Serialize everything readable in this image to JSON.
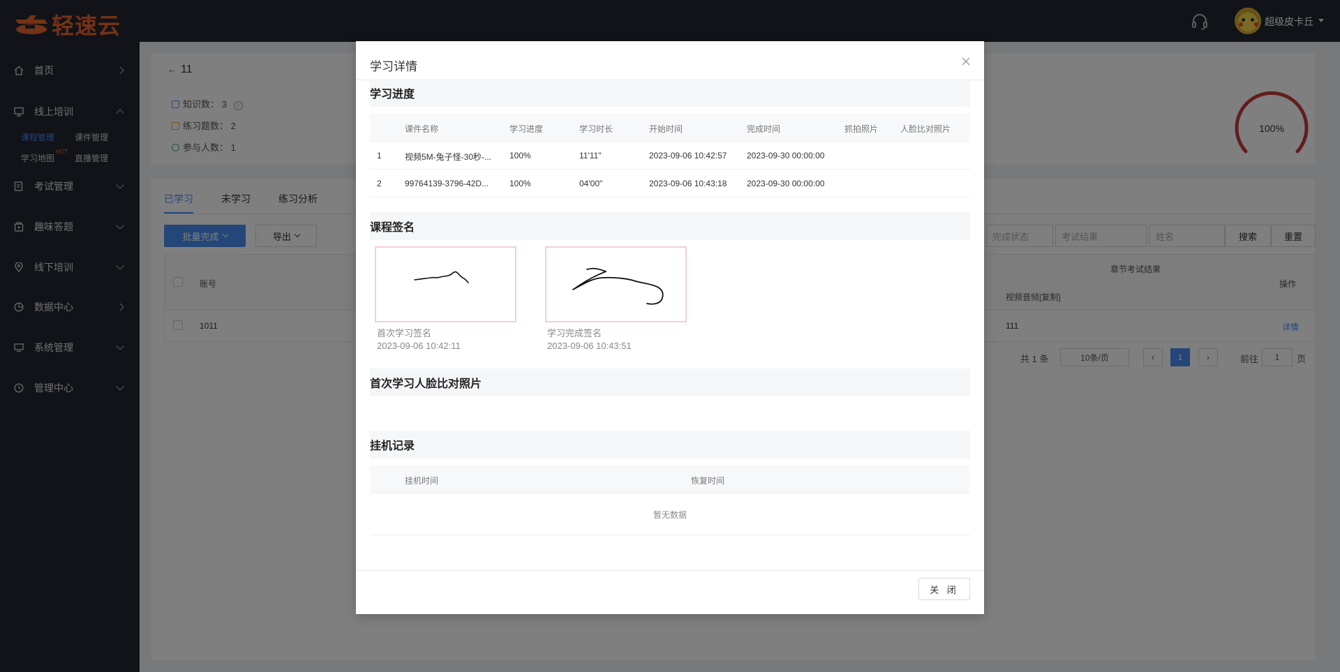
{
  "brand": {
    "logo_text": "轻速云",
    "color": "#e8642c"
  },
  "header": {
    "username": "超级皮卡丘"
  },
  "sidebar": {
    "items": [
      {
        "label": "首页",
        "icon": "home-icon"
      },
      {
        "label": "线上培训",
        "icon": "monitor-icon"
      },
      {
        "label": "考试管理",
        "icon": "exam-icon"
      },
      {
        "label": "趣味答题",
        "icon": "quiz-icon"
      },
      {
        "label": "线下培训",
        "icon": "location-icon"
      },
      {
        "label": "数据中心",
        "icon": "chart-icon"
      },
      {
        "label": "系统管理",
        "icon": "desktop-icon"
      },
      {
        "label": "管理中心",
        "icon": "clock-icon"
      }
    ],
    "subitems": {
      "course": "课程管理",
      "courseware": "课件管理",
      "map": "学习地图",
      "hot": "HOT",
      "live": "直播管理"
    }
  },
  "page": {
    "title": "11",
    "stats": [
      {
        "label": "知识数：",
        "value": "3"
      },
      {
        "label": "练习题数：",
        "value": "2"
      },
      {
        "label": "参与人数：",
        "value": "1"
      }
    ],
    "progress_label": "100%",
    "progress_value": 1.0,
    "tabs": [
      "已学习",
      "未学习",
      "练习分析"
    ],
    "batch_button": "批量完成",
    "export_button": "导出",
    "filters": {
      "status_placeholder": "完成状态",
      "result_placeholder": "考试结果",
      "name_placeholder": "姓名",
      "search": "搜索",
      "reset": "重置"
    },
    "table": {
      "col_account": "账号",
      "col_chapter_result": "章节考试结果",
      "col_video": "视频音频[复制]",
      "col_action": "操作",
      "row_account": "1011",
      "row_video": "111",
      "row_action": "详情"
    },
    "pager": {
      "total": "共 1 条",
      "page_size": "10条/页",
      "current": "1",
      "goto": "前往",
      "goto_value": "1",
      "page_unit": "页"
    }
  },
  "modal": {
    "title": "学习详情",
    "sections": {
      "progress": "学习进度",
      "signature": "课程签名",
      "face": "首次学习人脸比对照片",
      "idle": "挂机记录"
    },
    "progress_table": {
      "headers": [
        "课件名称",
        "学习进度",
        "学习时长",
        "开始时间",
        "完成时间",
        "抓拍照片",
        "人脸比对照片"
      ],
      "rows": [
        {
          "index": "1",
          "name": "视频5M-兔子怪-30秒-...",
          "progress": "100%",
          "duration": "11'11\"",
          "start": "2023-09-06 10:42:57",
          "end": "2023-09-30 00:00:00"
        },
        {
          "index": "2",
          "name": "99764139-3796-42D...",
          "progress": "100%",
          "duration": "04'00\"",
          "start": "2023-09-06 10:43:18",
          "end": "2023-09-30 00:00:00"
        }
      ]
    },
    "signatures": [
      {
        "label": "首次学习签名",
        "time": "2023-09-06 10:42:11"
      },
      {
        "label": "学习完成签名",
        "time": "2023-09-06 10:43:51"
      }
    ],
    "idle_table": {
      "headers": [
        "挂机时间",
        "恢复时间"
      ],
      "empty": "暂无数据"
    },
    "close_button": "关 闭"
  }
}
